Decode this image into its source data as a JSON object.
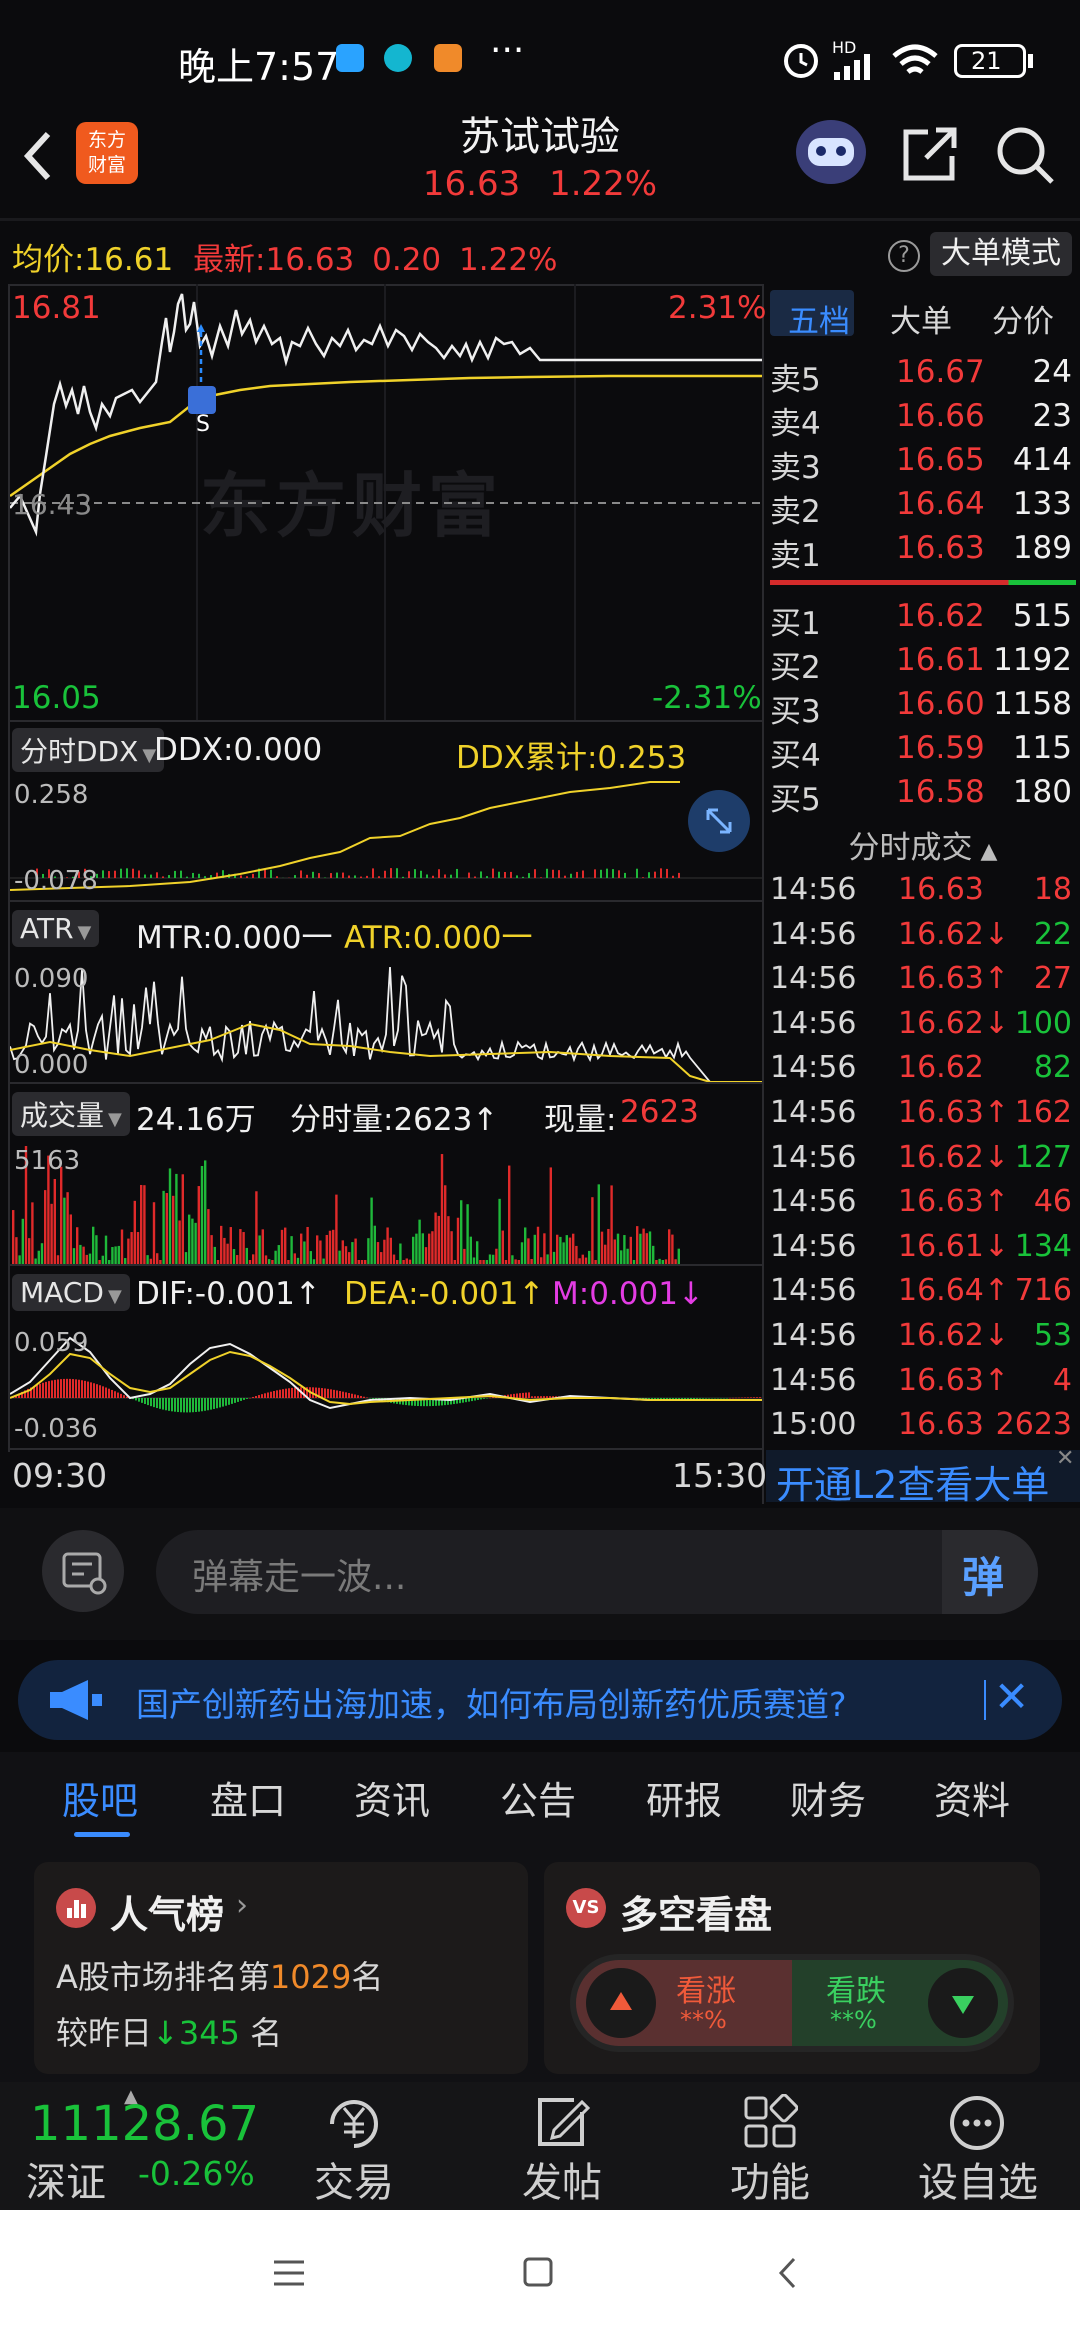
{
  "status_bar": {
    "time": "晚上7:57",
    "dots": "···",
    "hd": "HD",
    "battery": "21"
  },
  "header": {
    "title": "苏试试验",
    "price": "16.63",
    "change_pct": "1.22%",
    "logo_line1": "东方",
    "logo_line2": "财富"
  },
  "info_bar": {
    "avg_label": "均价:",
    "avg_value": "16.61",
    "latest_label": "最新:",
    "latest_value": "16.63",
    "change": "0.20",
    "change_pct": "1.22%",
    "help": "?",
    "mode_button": "大单模式"
  },
  "intraday": {
    "high": "16.81",
    "low": "16.05",
    "mid": "16.43",
    "high_pct": "2.31%",
    "low_pct": "-2.31%",
    "watermark": "东方财富",
    "marker": "S",
    "time_start": "09:30",
    "time_end": "15:30"
  },
  "ddx": {
    "selector": "分时DDX",
    "ddx_label": "DDX:0.000",
    "cum_label": "DDX累计:0.253",
    "top": "0.258",
    "bottom": "-0.078"
  },
  "atr": {
    "selector": "ATR",
    "mtr_label": "MTR:0.000一",
    "atr_label": "ATR:0.000一",
    "top": "0.090",
    "bottom": "0.000"
  },
  "volume": {
    "selector": "成交量",
    "total": "24.16万",
    "minute_label": "分时量:2623↑",
    "now_label": "现量:",
    "now_value": "2623",
    "top": "5163"
  },
  "macd": {
    "selector": "MACD",
    "dif": "DIF:-0.001↑",
    "dea": "DEA:-0.001↑",
    "m": "M:0.001↓",
    "top": "0.059",
    "bottom": "-0.036"
  },
  "order_book": {
    "tabs": [
      "五档",
      "大单",
      "分价"
    ],
    "asks": [
      {
        "label": "卖5",
        "price": "16.67",
        "vol": "24"
      },
      {
        "label": "卖4",
        "price": "16.66",
        "vol": "23"
      },
      {
        "label": "卖3",
        "price": "16.65",
        "vol": "414"
      },
      {
        "label": "卖2",
        "price": "16.64",
        "vol": "133"
      },
      {
        "label": "卖1",
        "price": "16.63",
        "vol": "189"
      }
    ],
    "bids": [
      {
        "label": "买1",
        "price": "16.62",
        "vol": "515"
      },
      {
        "label": "买2",
        "price": "16.61",
        "vol": "1192"
      },
      {
        "label": "买3",
        "price": "16.60",
        "vol": "1158"
      },
      {
        "label": "买4",
        "price": "16.59",
        "vol": "115"
      },
      {
        "label": "买5",
        "price": "16.58",
        "vol": "180"
      }
    ]
  },
  "trades": {
    "title": "分时成交",
    "rows": [
      {
        "time": "14:56",
        "price": "16.63",
        "vol": "18",
        "dir": "",
        "c": "red"
      },
      {
        "time": "14:56",
        "price": "16.62↓",
        "vol": "22",
        "dir": "down",
        "c": "green"
      },
      {
        "time": "14:56",
        "price": "16.63↑",
        "vol": "27",
        "dir": "up",
        "c": "red"
      },
      {
        "time": "14:56",
        "price": "16.62↓",
        "vol": "100",
        "dir": "down",
        "c": "green"
      },
      {
        "time": "14:56",
        "price": "16.62",
        "vol": "82",
        "dir": "",
        "c": "green"
      },
      {
        "time": "14:56",
        "price": "16.63↑",
        "vol": "162",
        "dir": "up",
        "c": "red"
      },
      {
        "time": "14:56",
        "price": "16.62↓",
        "vol": "127",
        "dir": "down",
        "c": "green"
      },
      {
        "time": "14:56",
        "price": "16.63↑",
        "vol": "46",
        "dir": "up",
        "c": "red"
      },
      {
        "time": "14:56",
        "price": "16.61↓",
        "vol": "134",
        "dir": "down",
        "c": "green"
      },
      {
        "time": "14:56",
        "price": "16.64↑",
        "vol": "716",
        "dir": "up",
        "c": "red"
      },
      {
        "time": "14:56",
        "price": "16.62↓",
        "vol": "53",
        "dir": "down",
        "c": "green"
      },
      {
        "time": "14:56",
        "price": "16.63↑",
        "vol": "4",
        "dir": "up",
        "c": "red"
      },
      {
        "time": "15:00",
        "price": "16.63",
        "vol": "2623",
        "dir": "",
        "c": "red"
      }
    ],
    "l2_link": "开通L2查看大单"
  },
  "danmu": {
    "placeholder": "弹幕走一波...",
    "send": "弹"
  },
  "banner": {
    "text": "国产创新药出海加速，如何布局创新药优质赛道?"
  },
  "tabs": [
    "股吧",
    "盘口",
    "资讯",
    "公告",
    "研报",
    "财务",
    "资料"
  ],
  "popularity": {
    "title": "人气榜",
    "rank_prefix": "A股市场排名第",
    "rank": "1029",
    "rank_suffix": "名",
    "change_prefix": "较昨日",
    "change": "345",
    "change_suffix": "名"
  },
  "sentiment": {
    "title": "多空看盘",
    "bull": "看涨",
    "bull_pct": "**%",
    "bear": "看跌",
    "bear_pct": "**%"
  },
  "index": {
    "value": "11128.67",
    "name": "深证",
    "change": "-0.26%"
  },
  "bottom_nav": [
    "交易",
    "发帖",
    "功能",
    "设自选"
  ],
  "colors": {
    "up": "#f23a3a",
    "down": "#19c23a",
    "accent": "#1e88e5",
    "yellow": "#f0d22a"
  }
}
